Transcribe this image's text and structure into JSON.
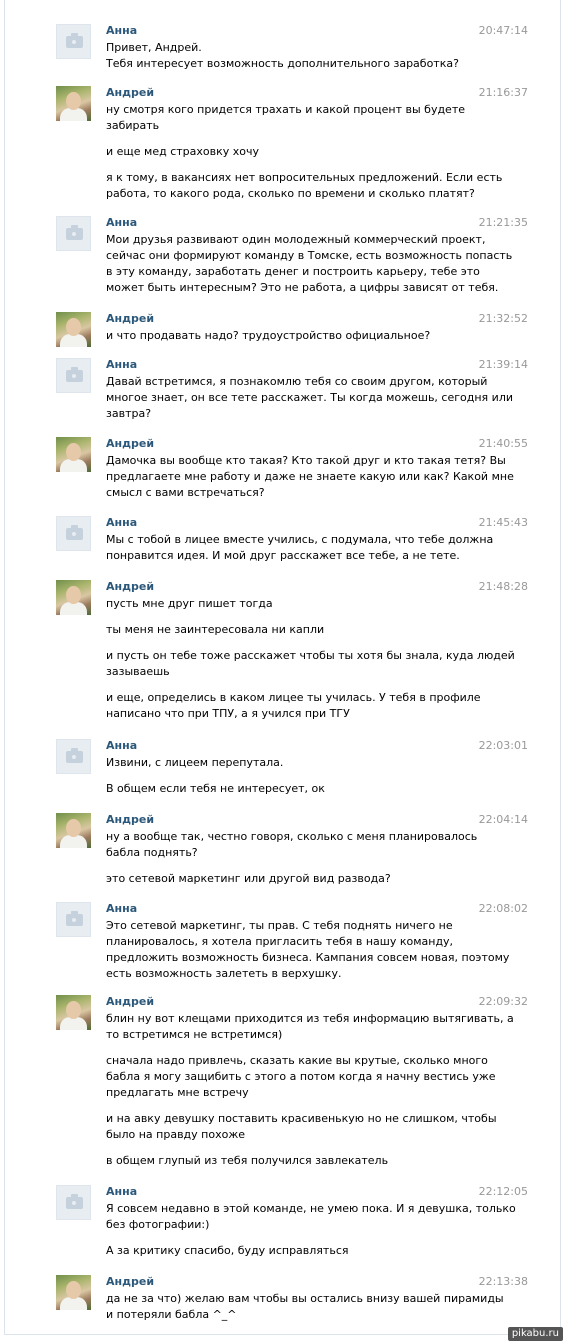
{
  "messages": [
    {
      "author": "Анна",
      "time": "20:47:14",
      "lines": [
        "Привет, Андрей.",
        "Тебя интересует возможность дополнительного заработка?"
      ]
    },
    {
      "author": "Андрей",
      "time": "21:16:37",
      "lines": [
        "ну смотря кого придется трахать и какой процент вы будете",
        "забирать",
        "",
        "и еще мед страховку хочу",
        "",
        "я к тому, в вакансиях нет вопросительных предложений. Если есть",
        "работа, то какого рода, сколько по времени и сколько платят?"
      ]
    },
    {
      "author": "Анна",
      "time": "21:21:35",
      "lines": [
        "Мои друзья развивают один молодежный коммерческий проект,",
        "сейчас они формируют команду в Томске, есть возможность попасть",
        "в эту команду, заработать денег и построить карьеру, тебе это",
        "может быть интересным? Это не работа, а цифры зависят от тебя."
      ]
    },
    {
      "author": "Андрей",
      "time": "21:32:52",
      "lines": [
        "и что продавать надо? трудоустройство официальное?"
      ]
    },
    {
      "author": "Анна",
      "time": "21:39:14",
      "lines": [
        "Давай встретимся, я познакомлю тебя со своим другом, который",
        "многое знает, он все тете расскажет. Ты когда можешь, сегодня или",
        "завтра?"
      ]
    },
    {
      "author": "Андрей",
      "time": "21:40:55",
      "lines": [
        "Дамочка вы вообще кто такая? Кто такой друг и кто такая тетя? Вы",
        "предлагаете мне работу и даже не знаете какую или как? Какой мне",
        "смысл с вами встречаться?"
      ]
    },
    {
      "author": "Анна",
      "time": "21:45:43",
      "lines": [
        "Мы с тобой в лицее вместе учились, с подумала, что тебе должна",
        "понравится идея. И мой друг расскажет все тебе, а не тете."
      ]
    },
    {
      "author": "Андрей",
      "time": "21:48:28",
      "lines": [
        "пусть мне друг пишет тогда",
        "",
        "ты меня не заинтересовала ни капли",
        "",
        "и пусть он тебе тоже расскажет чтобы ты хотя бы знала, куда людей",
        "зазываешь",
        "",
        "и еще, определись в каком лицее ты училась. У тебя в профиле",
        "написано что при ТПУ, а я учился при ТГУ"
      ]
    },
    {
      "author": "Анна",
      "time": "22:03:01",
      "lines": [
        "Извини, с лицеем перепутала.",
        "",
        "В общем если тебя не интересует, ок"
      ]
    },
    {
      "author": "Андрей",
      "time": "22:04:14",
      "lines": [
        "ну а вообще так, честно говоря, сколько с меня планировалось",
        "бабла поднять?",
        "",
        "это сетевой маркетинг или другой вид развода?"
      ]
    },
    {
      "author": "Анна",
      "time": "22:08:02",
      "lines": [
        "Это сетевой маркетинг, ты прав. С тебя поднять ничего не",
        "планировалось, я хотела пригласить тебя в нашу команду,",
        "предложить возможность бизнеса. Кампания совсем новая, поэтому",
        "есть возможность залететь в верхушку."
      ]
    },
    {
      "author": "Андрей",
      "time": "22:09:32",
      "lines": [
        "блин ну вот клещами приходится из тебя информацию вытягивать, а",
        "то встретимся не встретимся)",
        "",
        "сначала надо привлечь, сказать какие вы крутые, сколько много",
        "бабла я могу защибить с этого а потом когда я начну вестись уже",
        "предлагать мне встречу",
        "",
        "и на авку девушку поставить красивенькую но не слишком, чтобы",
        "было на правду похоже",
        "",
        "в общем глупый из тебя получился завлекатель"
      ]
    },
    {
      "author": "Анна",
      "time": "22:12:05",
      "lines": [
        "Я совсем недавно в этой команде, не умею пока. И я девушка, только",
        "без фотографии:)",
        "",
        "А за критику спасибо, буду исправляться"
      ]
    },
    {
      "author": "Андрей",
      "time": "22:13:38",
      "lines": [
        "да не за что) желаю вам чтобы вы остались внизу вашей пирамиды",
        "и потеряли бабла ^_^"
      ]
    }
  ],
  "watermark": "pikabu.ru"
}
